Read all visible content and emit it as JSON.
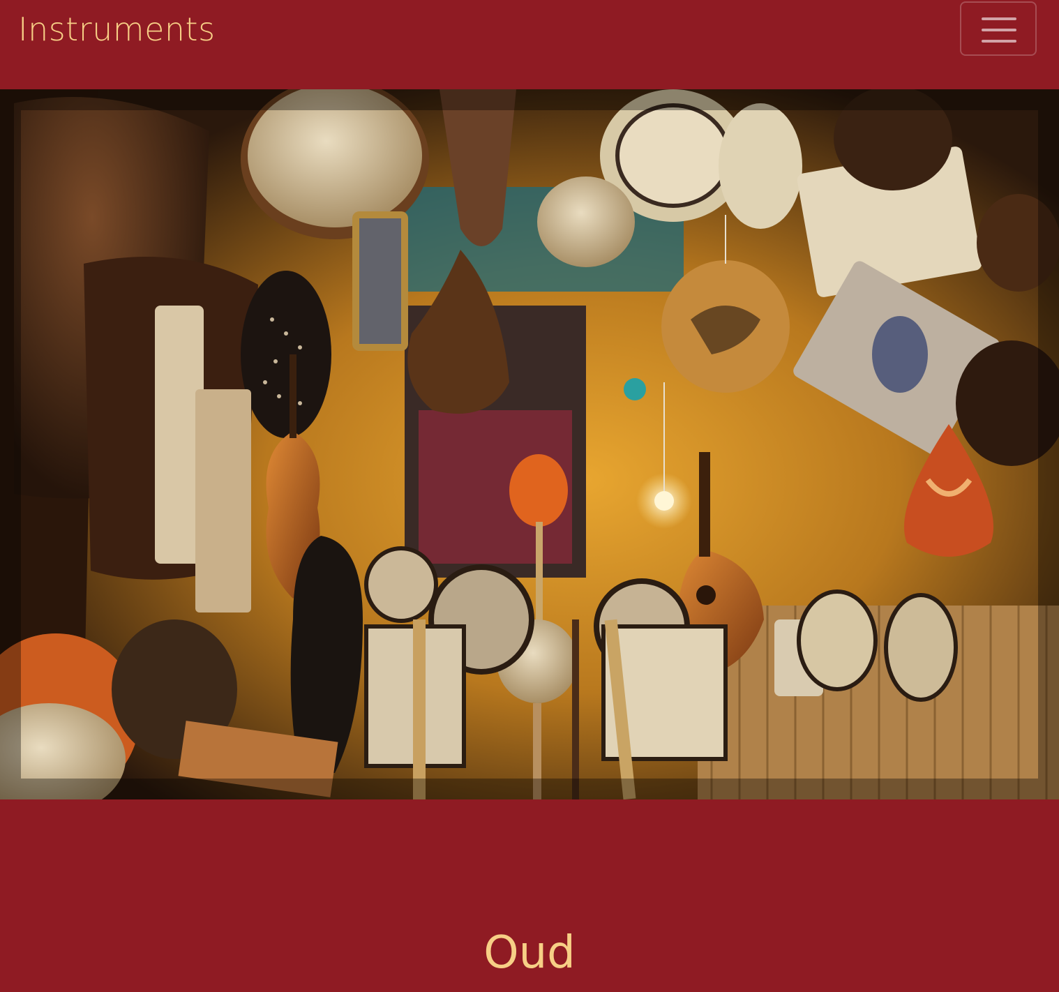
{
  "navbar": {
    "brand": "Instruments",
    "toggler_icon": "hamburger-menu-icon"
  },
  "hero": {
    "image_subject": "photo-illustration"
  },
  "section": {
    "title": "Oud"
  },
  "colors": {
    "background": "#8f1b23",
    "accent_text": "#f7cf86"
  }
}
